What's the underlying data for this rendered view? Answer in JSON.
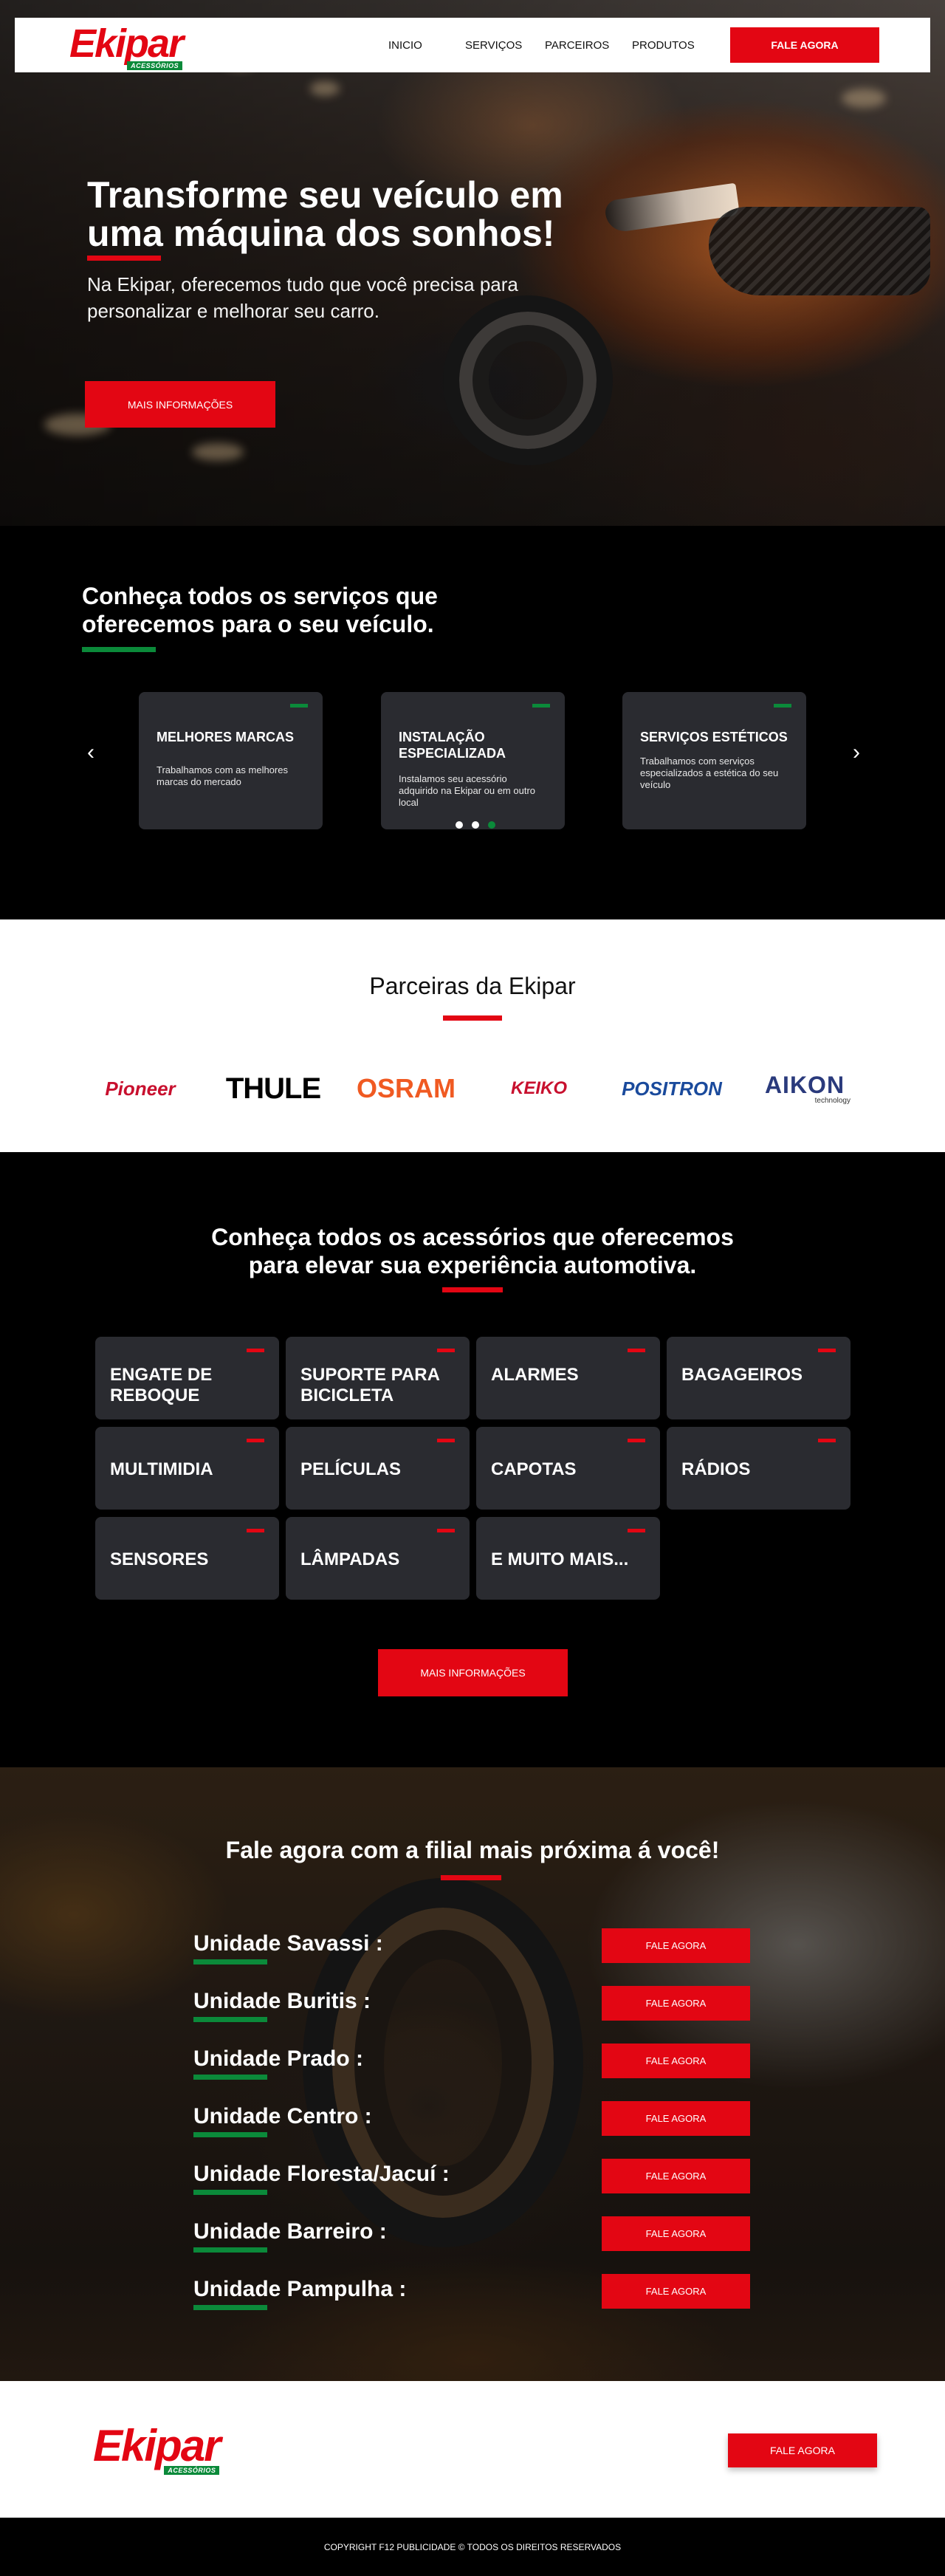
{
  "brand": {
    "logo_word": "Ekipar",
    "logo_tag": "ACESSÓRIOS",
    "accent": "#e30613",
    "secondary": "#0b8a3a"
  },
  "nav": {
    "items": [
      "INICIO",
      "SERVIÇOS",
      "PARCEIROS",
      "PRODUTOS"
    ],
    "cta": "FALE AGORA"
  },
  "hero": {
    "title": "Transforme seu veículo em uma máquina dos sonhos!",
    "subtitle": "Na Ekipar, oferecemos tudo que você precisa para personalizar e melhorar seu carro.",
    "button": "MAIS INFORMAÇÕES"
  },
  "services": {
    "title": "Conheça todos os serviços que oferecemos para o seu veículo.",
    "prev_icon": "chevron-left-icon",
    "next_icon": "chevron-right-icon",
    "cards": [
      {
        "title": "MELHORES MARCAS",
        "text": "Trabalhamos com as melhores marcas do mercado"
      },
      {
        "title": "INSTALAÇÃO ESPECIALIZADA",
        "text": "Instalamos seu acessório adquirido na Ekipar ou em outro local"
      },
      {
        "title": "SERVIÇOS ESTÉTICOS",
        "text": "Trabalhamos com serviços especializados a estética do seu veículo"
      }
    ]
  },
  "partners": {
    "title": "Parceiras da Ekipar",
    "brands": [
      "Pioneer",
      "THULE",
      "OSRAM",
      "KEIKO",
      "POSITRON",
      "AIKON",
      "technology"
    ]
  },
  "accessories": {
    "title": "Conheça todos os acessórios que oferecemos para elevar sua experiência automotiva.",
    "items": [
      "ENGATE DE REBOQUE",
      "SUPORTE PARA BICICLETA",
      "ALARMES",
      "BAGAGEIROS",
      "MULTIMIDIA",
      "PELÍCULAS",
      "CAPOTAS",
      "RÁDIOS",
      "SENSORES",
      "LÂMPADAS",
      "E MUITO MAIS..."
    ],
    "button": "MAIS INFORMAÇÕES"
  },
  "branches": {
    "title": "Fale agora com a filial mais próxima á você!",
    "button": "FALE AGORA",
    "units": [
      "Unidade Savassi :",
      "Unidade Buritis :",
      "Unidade Prado :",
      "Unidade Centro :",
      "Unidade Floresta/Jacuí :",
      "Unidade Barreiro :",
      "Unidade Pampulha :"
    ]
  },
  "footer": {
    "button": "FALE AGORA",
    "copyright": "COPYRIGHT F12 PUBLICIDADE © TODOS OS DIREITOS RESERVADOS"
  }
}
